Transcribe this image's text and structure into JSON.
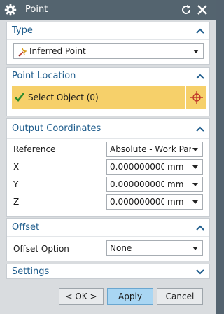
{
  "window": {
    "title": "Point",
    "icons": [
      "gear-icon",
      "reset-icon",
      "close-icon"
    ]
  },
  "type_section": {
    "title": "Type",
    "selected": "Inferred Point",
    "icon": "inferred-point-icon"
  },
  "point_location": {
    "title": "Point Location",
    "select_label": "Select Object (0)",
    "highlight_color": "#f6d06a"
  },
  "output_coordinates": {
    "title": "Output Coordinates",
    "reference_label": "Reference",
    "reference_value": "Absolute - Work Part",
    "fields": [
      {
        "label": "X",
        "value": "0.0000000000(",
        "unit": "mm"
      },
      {
        "label": "Y",
        "value": "0.0000000000(",
        "unit": "mm"
      },
      {
        "label": "Z",
        "value": "0.0000000000(",
        "unit": "mm"
      }
    ]
  },
  "offset": {
    "title": "Offset",
    "option_label": "Offset Option",
    "option_value": "None"
  },
  "settings": {
    "title": "Settings"
  },
  "buttons": {
    "ok": "< OK >",
    "apply": "Apply",
    "cancel": "Cancel"
  },
  "colors": {
    "titlebar": "#54646f",
    "section_title": "#1e5c8c",
    "primary_button": "#a9d6f3"
  }
}
